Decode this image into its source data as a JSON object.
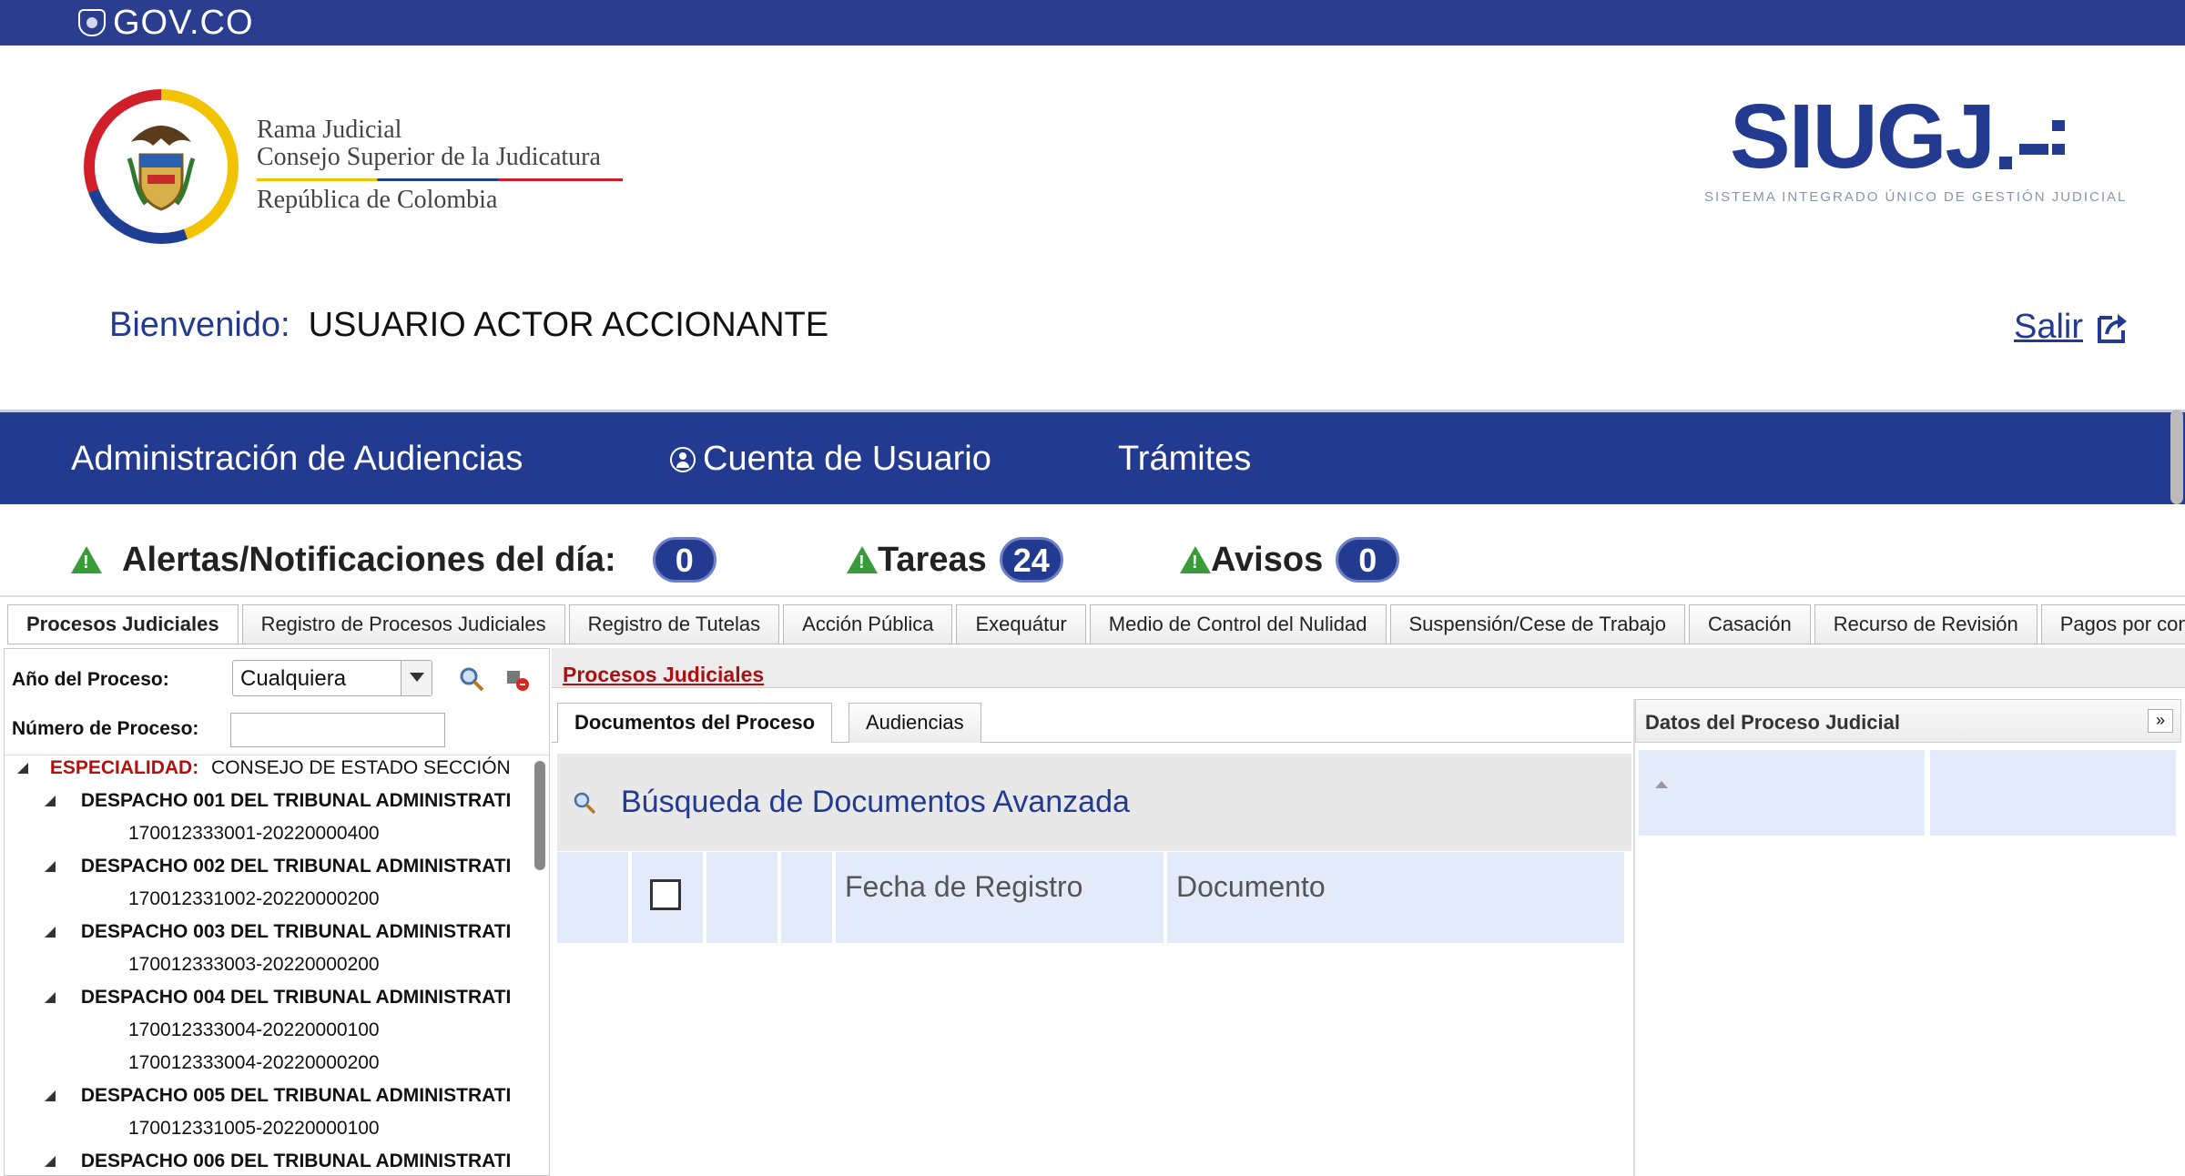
{
  "gov_bar": {
    "label": "GOV.CO"
  },
  "org": {
    "line1": "Rama Judicial",
    "line2": "Consejo Superior de la Judicatura",
    "line3": "República de Colombia"
  },
  "brand": {
    "name": "SIUGJ",
    "subtitle": "SISTEMA INTEGRADO ÚNICO DE GESTIÓN JUDICIAL",
    "color": "#223a8f"
  },
  "welcome": {
    "label": "Bienvenido:",
    "user": "USUARIO ACTOR ACCIONANTE"
  },
  "logout": {
    "label": "Salir",
    "icon": "logout-icon"
  },
  "nav": {
    "items": [
      {
        "label": "Administración de Audiencias"
      },
      {
        "label": "Cuenta de Usuario",
        "icon": "user-circle-icon"
      },
      {
        "label": "Trámites"
      }
    ]
  },
  "alerts": {
    "items": [
      {
        "label": "Alertas/Notificaciones del día:",
        "count": "0",
        "icon": "warning-icon"
      },
      {
        "label": "Tareas",
        "count": "24",
        "icon": "warning-icon"
      },
      {
        "label": "Avisos",
        "count": "0",
        "icon": "warning-icon"
      }
    ],
    "warning_color": "#3a9b3a"
  },
  "tabs": [
    {
      "label": "Procesos Judiciales",
      "active": true
    },
    {
      "label": "Registro de Procesos Judiciales"
    },
    {
      "label": "Registro de Tutelas"
    },
    {
      "label": "Acción Pública"
    },
    {
      "label": "Exequátur"
    },
    {
      "label": "Medio de Control del Nulidad"
    },
    {
      "label": "Suspensión/Cese de Trabajo"
    },
    {
      "label": "Casación"
    },
    {
      "label": "Recurso de Revisión"
    },
    {
      "label": "Pagos por consignaci"
    }
  ],
  "filters": {
    "year_label": "Año del Proceso:",
    "year_value": "Cualquiera",
    "number_label": "Número de Proceso:",
    "number_value": ""
  },
  "tree": {
    "especialidad_label": "ESPECIALIDAD:",
    "especialidad_value": "CONSEJO DE ESTADO SECCIÓN",
    "despachos": [
      {
        "name": "DESPACHO 001 DEL TRIBUNAL ADMINISTRATI",
        "procesos": [
          "170012333001-20220000400"
        ]
      },
      {
        "name": "DESPACHO 002 DEL TRIBUNAL ADMINISTRATI",
        "procesos": [
          "170012331002-20220000200"
        ]
      },
      {
        "name": "DESPACHO 003 DEL TRIBUNAL ADMINISTRATI",
        "procesos": [
          "170012333003-20220000200"
        ]
      },
      {
        "name": "DESPACHO 004 DEL TRIBUNAL ADMINISTRATI",
        "procesos": [
          "170012333004-20220000100",
          "170012333004-20220000200"
        ]
      },
      {
        "name": "DESPACHO 005 DEL TRIBUNAL ADMINISTRATI",
        "procesos": [
          "170012331005-20220000100"
        ]
      },
      {
        "name": "DESPACHO 006 DEL TRIBUNAL ADMINISTRATI",
        "procesos": []
      }
    ]
  },
  "main": {
    "section_link": "Procesos Judiciales",
    "subtabs": [
      {
        "label": "Documentos del Proceso",
        "active": true
      },
      {
        "label": "Audiencias"
      }
    ],
    "advanced_search": "Búsqueda de Documentos Avanzada",
    "columns": [
      "",
      "",
      "",
      "",
      "Fecha de Registro",
      "Documento"
    ]
  },
  "details": {
    "title": "Datos del Proceso Judicial",
    "collapse_label": "»"
  }
}
